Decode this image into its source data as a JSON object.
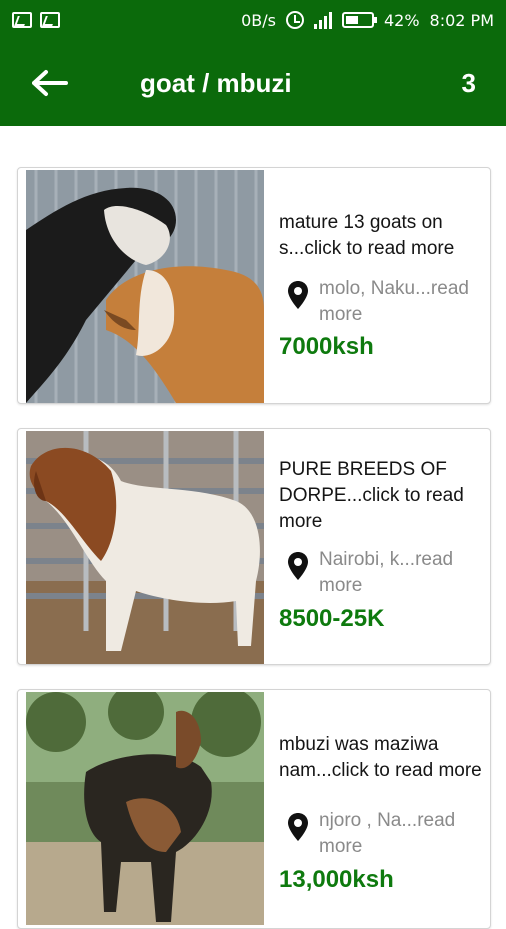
{
  "status_bar": {
    "net_speed": "0B/s",
    "battery": "42%",
    "time": "8:02 PM",
    "icons": [
      "gallery-icon",
      "activity-icon",
      "alarm-icon",
      "lte-signal-icon",
      "battery-icon"
    ]
  },
  "app_bar": {
    "back_icon": "arrow-left-icon",
    "title": "goat / mbuzi",
    "count": "3",
    "color": "#0b6a0b"
  },
  "listings": [
    {
      "description": "mature 13 goats on s...click to read more",
      "location": "molo, Naku...read more",
      "price": "7000ksh"
    },
    {
      "description": "PURE BREEDS OF DORPE...click to read more",
      "location": "Nairobi, k...read more",
      "price": "8500-25K"
    },
    {
      "description": "mbuzi was maziwa nam...click to read more",
      "location": "njoro , Na...read more",
      "price": "13,000ksh"
    }
  ],
  "colors": {
    "price": "#0e7a0e",
    "location": "#8a8a8a"
  }
}
